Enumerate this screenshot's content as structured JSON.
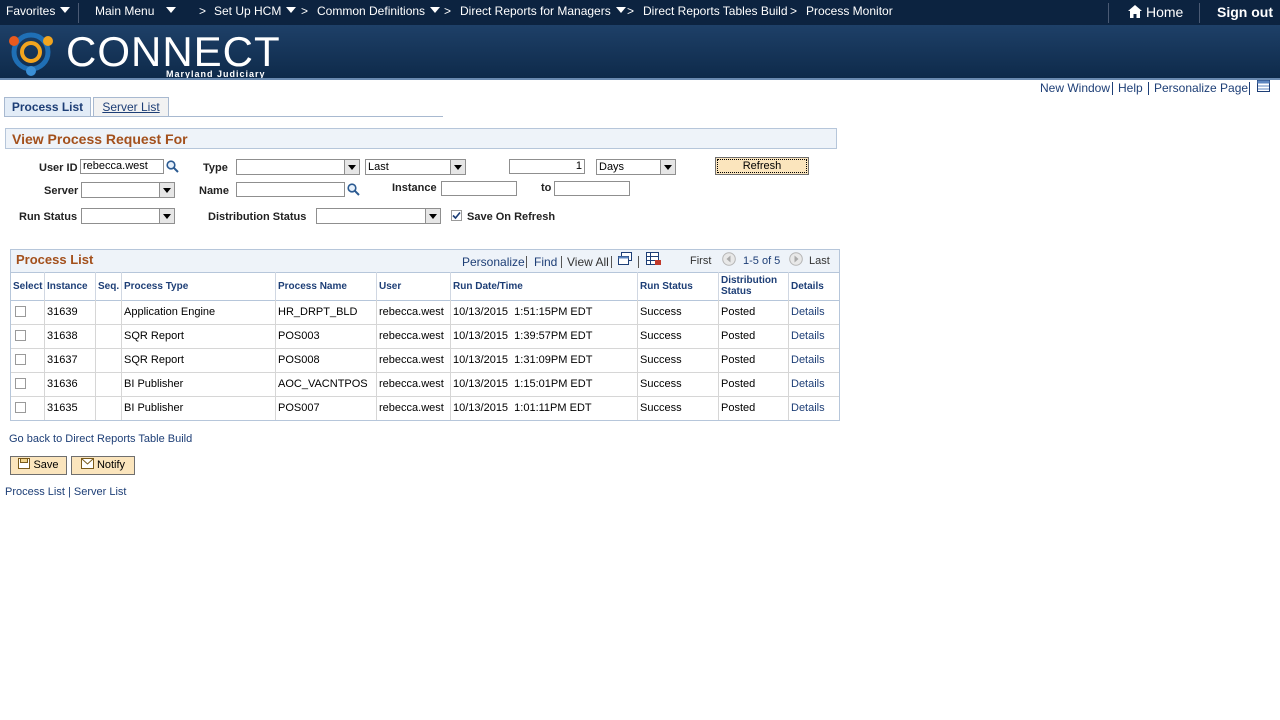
{
  "topnav": {
    "favorites": "Favorites",
    "main_menu": "Main Menu",
    "setup_hcm": "Set Up HCM",
    "common_definitions": "Common Definitions",
    "direct_reports_managers": "Direct Reports for Managers",
    "direct_reports_tables_build": "Direct Reports Tables Build",
    "process_monitor": "Process Monitor",
    "home": "Home",
    "sign_out": "Sign out"
  },
  "banner": {
    "logo_text": "CONNECT",
    "logo_sub": "Maryland Judiciary"
  },
  "page_links": {
    "new_window": "New Window",
    "help": "Help",
    "personalize_page": "Personalize Page"
  },
  "tabs": [
    {
      "label": "Process List",
      "active": true
    },
    {
      "label": "Server List",
      "active": false
    }
  ],
  "filter": {
    "title": "View Process Request For",
    "user_id_label": "User ID",
    "user_id_value": "rebecca.west",
    "type_label": "Type",
    "type_value": "",
    "last_value": "Last",
    "count_value": "1",
    "days_value": "Days",
    "refresh_label": "Refresh",
    "server_label": "Server",
    "server_value": "",
    "name_label": "Name",
    "name_value": "",
    "instance_label": "Instance",
    "instance_from": "",
    "to_label": "to",
    "instance_to": "",
    "run_status_label": "Run Status",
    "run_status_value": "",
    "dist_status_label": "Distribution Status",
    "dist_status_value": "",
    "save_on_refresh_label": "Save On Refresh",
    "save_on_refresh_checked": true
  },
  "process_list": {
    "title": "Process List",
    "personalize": "Personalize",
    "find": "Find",
    "view_all": "View All",
    "first": "First",
    "range": "1-5 of 5",
    "last": "Last",
    "columns": [
      "Select",
      "Instance",
      "Seq.",
      "Process Type",
      "Process Name",
      "User",
      "Run Date/Time",
      "Run Status",
      "Distribution Status",
      "Details"
    ],
    "rows": [
      {
        "instance": "31639",
        "seq": "",
        "process_type": "Application Engine",
        "process_name": "HR_DRPT_BLD",
        "user": "rebecca.west",
        "run_date": "10/13/2015  1:51:15PM EDT",
        "run_status": "Success",
        "dist_status": "Posted",
        "details": "Details"
      },
      {
        "instance": "31638",
        "seq": "",
        "process_type": "SQR Report",
        "process_name": "POS003",
        "user": "rebecca.west",
        "run_date": "10/13/2015  1:39:57PM EDT",
        "run_status": "Success",
        "dist_status": "Posted",
        "details": "Details"
      },
      {
        "instance": "31637",
        "seq": "",
        "process_type": "SQR Report",
        "process_name": "POS008",
        "user": "rebecca.west",
        "run_date": "10/13/2015  1:31:09PM EDT",
        "run_status": "Success",
        "dist_status": "Posted",
        "details": "Details"
      },
      {
        "instance": "31636",
        "seq": "",
        "process_type": "BI Publisher",
        "process_name": "AOC_VACNTPOS",
        "user": "rebecca.west",
        "run_date": "10/13/2015  1:15:01PM EDT",
        "run_status": "Success",
        "dist_status": "Posted",
        "details": "Details"
      },
      {
        "instance": "31635",
        "seq": "",
        "process_type": "BI Publisher",
        "process_name": "POS007",
        "user": "rebecca.west",
        "run_date": "10/13/2015  1:01:11PM EDT",
        "run_status": "Success",
        "dist_status": "Posted",
        "details": "Details"
      }
    ]
  },
  "footer": {
    "go_back": "Go back to Direct Reports Table Build",
    "save": "Save",
    "notify": "Notify",
    "process_list_link": "Process List",
    "separator": "|",
    "server_list_link": "Server List"
  },
  "colors": {
    "nav_bg": "#0c2340",
    "link": "#1d3e76",
    "section_title": "#a3501c",
    "button_bg": "#fbe5bd"
  }
}
